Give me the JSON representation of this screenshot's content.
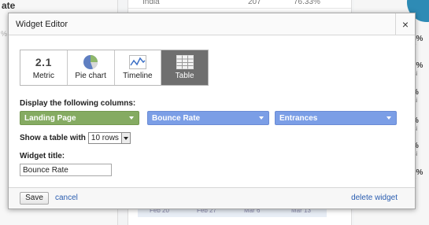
{
  "background": {
    "left_title": "ate",
    "left_pct": "%",
    "table_row": {
      "country": "India",
      "visits": "207",
      "rate": "76.33%"
    },
    "right_stats": [
      {
        "value": "5%",
        "sub": "V"
      },
      {
        "value": "7%",
        "sub": "isi"
      },
      {
        "value": "%",
        "sub": "isi"
      },
      {
        "value": "%",
        "sub": "isi"
      },
      {
        "value": "%",
        "sub": "isi"
      },
      {
        "value": "0%",
        "sub": "V"
      }
    ],
    "axis_labels": [
      "Feb 20",
      "Feb 27",
      "Mar 6",
      "Mar 13"
    ],
    "accent": "#2e8bb5"
  },
  "dialog": {
    "title": "Widget Editor",
    "close_label": "×",
    "widget_types": [
      {
        "label": "Metric",
        "icon": "metric-2.1-icon",
        "active": false
      },
      {
        "label": "Pie chart",
        "icon": "pie-chart-icon",
        "active": false
      },
      {
        "label": "Timeline",
        "icon": "timeline-icon",
        "active": false
      },
      {
        "label": "Table",
        "icon": "table-icon",
        "active": true
      }
    ],
    "metric_icon_text": "2.1",
    "columns_label": "Display the following columns:",
    "columns": [
      {
        "value": "Landing Page",
        "color": "#85ab62"
      },
      {
        "value": "Bounce Rate",
        "color": "#7b9ee6"
      },
      {
        "value": "Entrances",
        "color": "#7b9ee6"
      }
    ],
    "rows_label": "Show a table with",
    "rows_value": "10 rows",
    "widget_title_label": "Widget title:",
    "widget_title_value": "Bounce Rate",
    "save_label": "Save",
    "cancel_label": "cancel",
    "delete_label": "delete widget"
  }
}
